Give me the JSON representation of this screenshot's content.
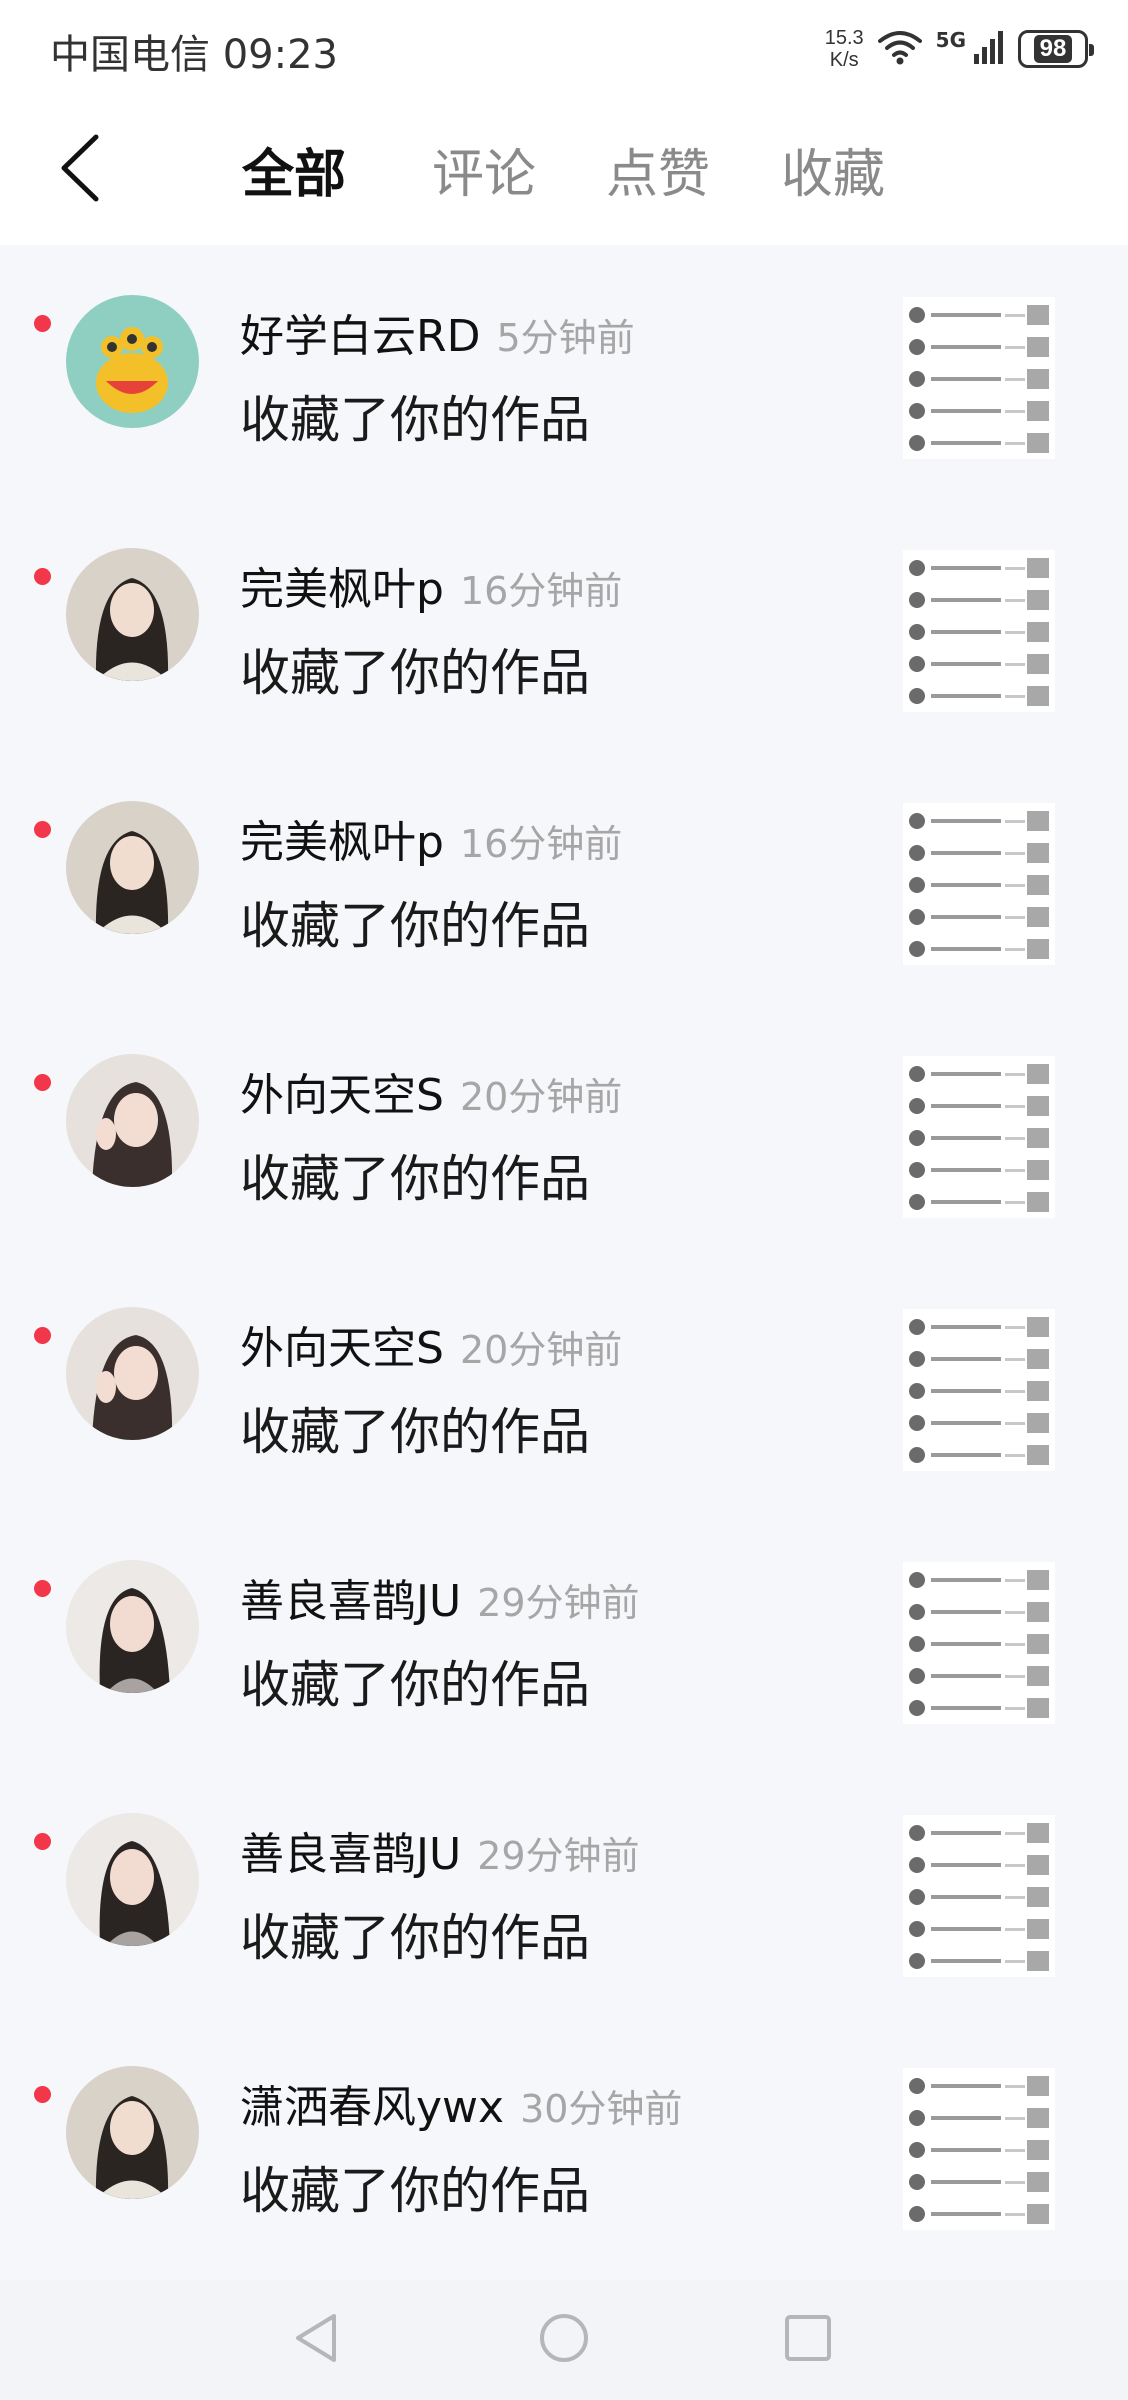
{
  "status_bar": {
    "carrier": "中国电信",
    "time": "09:23",
    "net_speed_value": "15.3",
    "net_speed_unit": "K/s",
    "network": "5G",
    "battery": "98"
  },
  "header": {
    "back_icon": "chevron-left-icon",
    "tabs": [
      {
        "label": "全部",
        "active": true
      },
      {
        "label": "评论",
        "active": false
      },
      {
        "label": "点赞",
        "active": false
      },
      {
        "label": "收藏",
        "active": false
      }
    ]
  },
  "notifications": [
    {
      "name": "好学白云RD",
      "time": "5分钟前",
      "action": "收藏了你的作品",
      "unread": true
    },
    {
      "name": "完美枫叶p",
      "time": "16分钟前",
      "action": "收藏了你的作品",
      "unread": true
    },
    {
      "name": "完美枫叶p",
      "time": "16分钟前",
      "action": "收藏了你的作品",
      "unread": true
    },
    {
      "name": "外向天空S",
      "time": "20分钟前",
      "action": "收藏了你的作品",
      "unread": true
    },
    {
      "name": "外向天空S",
      "time": "20分钟前",
      "action": "收藏了你的作品",
      "unread": true
    },
    {
      "name": "善良喜鹊JU",
      "time": "29分钟前",
      "action": "收藏了你的作品",
      "unread": true
    },
    {
      "name": "善良喜鹊JU",
      "time": "29分钟前",
      "action": "收藏了你的作品",
      "unread": true
    },
    {
      "name": "潇洒春风ywx",
      "time": "30分钟前",
      "action": "收藏了你的作品",
      "unread": true
    }
  ],
  "nav_bar": {
    "back_icon": "triangle-back-icon",
    "home_icon": "circle-home-icon",
    "recents_icon": "square-recents-icon"
  },
  "colors": {
    "unread_dot": "#f2374b",
    "active_tab": "#111111",
    "inactive_tab": "#8a8a8a",
    "timestamp": "#a6a6a6",
    "list_background": "#f6f7fa"
  }
}
